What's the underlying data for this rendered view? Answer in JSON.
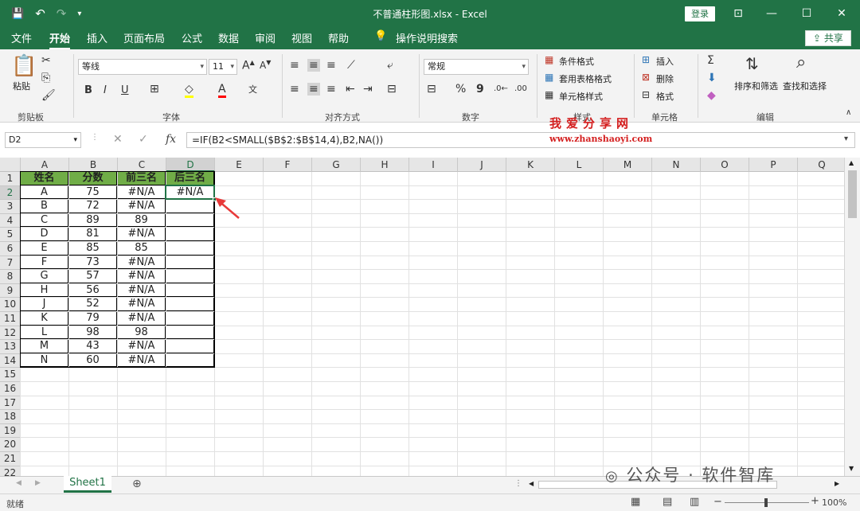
{
  "titlebar": {
    "title": "不普通柱形图.xlsx  -  Excel",
    "login_label": "登录",
    "qat": {
      "save": "💾",
      "undo": "↶",
      "redo": "↷"
    }
  },
  "tabs": [
    "文件",
    "开始",
    "插入",
    "页面布局",
    "公式",
    "数据",
    "审阅",
    "视图",
    "帮助"
  ],
  "active_tab": "开始",
  "tell_me": "操作说明搜索",
  "share_label": "共享",
  "ribbon": {
    "clipboard": {
      "paste": "粘贴",
      "label": "剪贴板"
    },
    "font": {
      "name": "等线",
      "size": "11",
      "label": "字体",
      "bold": "B",
      "italic": "I",
      "underline": "U"
    },
    "alignment": {
      "label": "对齐方式"
    },
    "number": {
      "format": "常规",
      "label": "数字",
      "percent": "%",
      "comma": "9"
    },
    "styles": {
      "conditional": "条件格式",
      "table": "套用表格格式",
      "cell": "单元格样式",
      "label": "样式"
    },
    "cells": {
      "insert": "插入",
      "delete": "删除",
      "format": "格式",
      "label": "单元格"
    },
    "editing": {
      "sort": "排序和筛选",
      "find": "查找和选择",
      "label": "编辑"
    }
  },
  "formula_bar": {
    "name_box": "D2",
    "formula": "=IF(B2<SMALL($B$2:$B$14,4),B2,NA())",
    "fx": "fx"
  },
  "watermark": {
    "cn": "我爱分享网",
    "url": "www.zhanshaoyi.com",
    "wechat": "公众号 · 软件智库"
  },
  "columns": [
    "A",
    "B",
    "C",
    "D",
    "E",
    "F",
    "G",
    "H",
    "I",
    "J",
    "K",
    "L",
    "M",
    "N",
    "O",
    "P",
    "Q"
  ],
  "rows": [
    "1",
    "2",
    "3",
    "4",
    "5",
    "6",
    "7",
    "8",
    "9",
    "10",
    "11",
    "12",
    "13",
    "14",
    "15",
    "16",
    "17",
    "18",
    "19",
    "20",
    "21",
    "22"
  ],
  "table": {
    "headers": [
      "姓名",
      "分数",
      "前三名",
      "后三名"
    ],
    "data": [
      [
        "A",
        "75",
        "#N/A",
        "#N/A"
      ],
      [
        "B",
        "72",
        "#N/A",
        ""
      ],
      [
        "C",
        "89",
        "89",
        ""
      ],
      [
        "D",
        "81",
        "#N/A",
        ""
      ],
      [
        "E",
        "85",
        "85",
        ""
      ],
      [
        "F",
        "73",
        "#N/A",
        ""
      ],
      [
        "G",
        "57",
        "#N/A",
        ""
      ],
      [
        "H",
        "56",
        "#N/A",
        ""
      ],
      [
        "J",
        "52",
        "#N/A",
        ""
      ],
      [
        "K",
        "79",
        "#N/A",
        ""
      ],
      [
        "L",
        "98",
        "98",
        ""
      ],
      [
        "M",
        "43",
        "#N/A",
        ""
      ],
      [
        "N",
        "60",
        "#N/A",
        ""
      ]
    ]
  },
  "selected_cell": "D2",
  "sheet_tab": "Sheet1",
  "status": {
    "ready": "就绪",
    "zoom": "100%"
  },
  "colors": {
    "excel_green": "#217346",
    "header_green": "#70ad47",
    "arrow_red": "#e83a3a"
  }
}
